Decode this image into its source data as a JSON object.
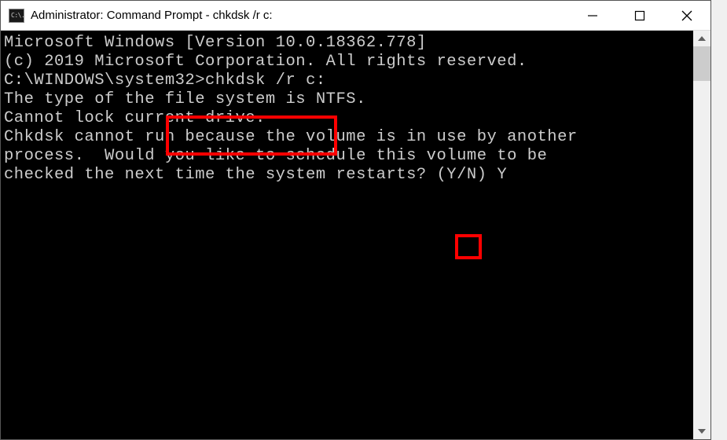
{
  "titlebar": {
    "icon_label": "C:\\.",
    "title": "Administrator: Command Prompt - chkdsk /r c:"
  },
  "terminal": {
    "line1": "Microsoft Windows [Version 10.0.18362.778]",
    "line2": "(c) 2019 Microsoft Corporation. All rights reserved.",
    "blank1": "",
    "prompt": "C:\\WINDOWS\\system32>",
    "command": "chkdsk /r c:",
    "line4": "The type of the file system is NTFS.",
    "line5": "Cannot lock current drive.",
    "blank2": "",
    "line6": "Chkdsk cannot run because the volume is in use by another",
    "line7": "process.  Would you like to schedule this volume to be",
    "line8a": "checked the next time the system restarts? (Y/N) ",
    "response": "Y"
  }
}
